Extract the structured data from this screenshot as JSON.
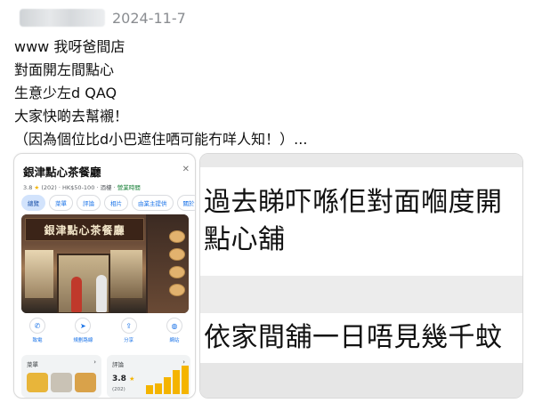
{
  "header": {
    "date": "2024-11-7"
  },
  "post": {
    "lines": [
      "www 我呀爸間店",
      "對面開左間點心",
      "生意少左d QAQ",
      "大家快啲去幫襯！",
      "（因為個位比d小巴遮住哂可能冇咩人知！）..."
    ]
  },
  "maps_card": {
    "title": "銀津點心茶餐廳",
    "rating": "3.8",
    "review_count": "(202)",
    "price": "HK$50-100",
    "category": "酒樓",
    "hours": "營業時間",
    "tabs": [
      "總覽",
      "菜單",
      "評論",
      "相片",
      "由業主提供",
      "關於"
    ],
    "photo_sign": "銀津點心茶餐廳",
    "actions": [
      {
        "label": "致電",
        "icon": "phone-icon"
      },
      {
        "label": "規劃路線",
        "icon": "directions-icon"
      },
      {
        "label": "分享",
        "icon": "share-icon"
      },
      {
        "label": "網站",
        "icon": "globe-icon"
      }
    ],
    "menu_label": "菜單",
    "reviews_label": "評論",
    "reviews_rating": "3.8",
    "reviews_count": "(202)",
    "rating_bars": [
      0.3,
      0.35,
      0.55,
      0.8,
      0.95
    ]
  },
  "quote_card": {
    "line1": "過去睇吓喺佢對面嗰度開",
    "line2": "點心舖",
    "line3": "依家間舖一日唔見幾千蚊"
  }
}
